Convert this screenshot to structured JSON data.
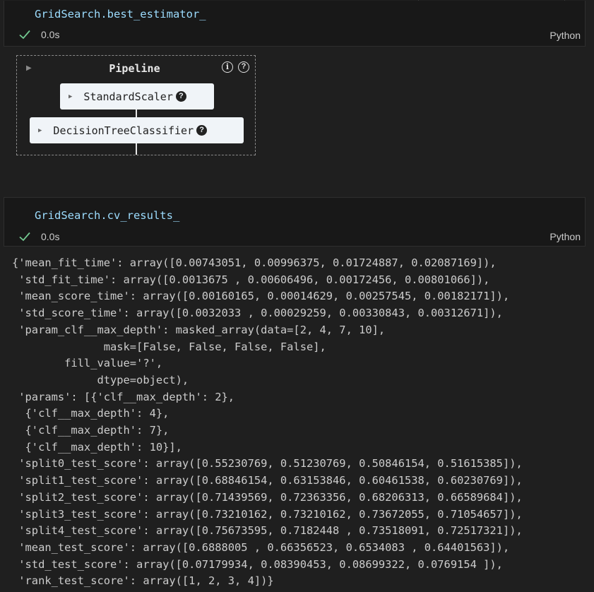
{
  "cells": [
    {
      "code": "GridSearch.best_estimator_",
      "status_time": "0.0s",
      "language": "Python"
    },
    {
      "code": "GridSearch.cv_results_",
      "status_time": "0.0s",
      "language": "Python"
    }
  ],
  "pipeline": {
    "title": "Pipeline",
    "info_icon": "i",
    "help_icon": "?",
    "steps": [
      {
        "label": "StandardScaler",
        "help": "?"
      },
      {
        "label": "DecisionTreeClassifier",
        "help": "?"
      }
    ]
  },
  "output_lines": [
    "{'mean_fit_time': array([0.00743051, 0.00996375, 0.01724887, 0.02087169]),",
    " 'std_fit_time': array([0.0013675 , 0.00606496, 0.00172456, 0.00801066]),",
    " 'mean_score_time': array([0.00160165, 0.00014629, 0.00257545, 0.00182171]),",
    " 'std_score_time': array([0.0032033 , 0.00029259, 0.00330843, 0.00312671]),",
    " 'param_clf__max_depth': masked_array(data=[2, 4, 7, 10],",
    "              mask=[False, False, False, False],",
    "        fill_value='?',",
    "             dtype=object),",
    " 'params': [{'clf__max_depth': 2},",
    "  {'clf__max_depth': 4},",
    "  {'clf__max_depth': 7},",
    "  {'clf__max_depth': 10}],",
    " 'split0_test_score': array([0.55230769, 0.51230769, 0.50846154, 0.51615385]),",
    " 'split1_test_score': array([0.68846154, 0.63153846, 0.60461538, 0.60230769]),",
    " 'split2_test_score': array([0.71439569, 0.72363356, 0.68206313, 0.66589684]),",
    " 'split3_test_score': array([0.73210162, 0.73210162, 0.73672055, 0.71054657]),",
    " 'split4_test_score': array([0.75673595, 0.7182448 , 0.73518091, 0.72517321]),",
    " 'mean_test_score': array([0.6888005 , 0.66356523, 0.6534083 , 0.64401563]),",
    " 'std_test_score': array([0.07179934, 0.08390453, 0.08699322, 0.0769154 ]),",
    " 'rank_test_score': array([1, 2, 3, 4])}"
  ],
  "colors": {
    "background": "#1f1f1f",
    "cell_background": "#181818",
    "code_text": "#9cdcfe",
    "success_check": "#73c991",
    "output_text": "#cccccc"
  },
  "icons": {
    "status": "checkmark-icon",
    "expand": "triangle-right-icon",
    "info": "info-circle-icon",
    "help": "question-circle-icon"
  }
}
